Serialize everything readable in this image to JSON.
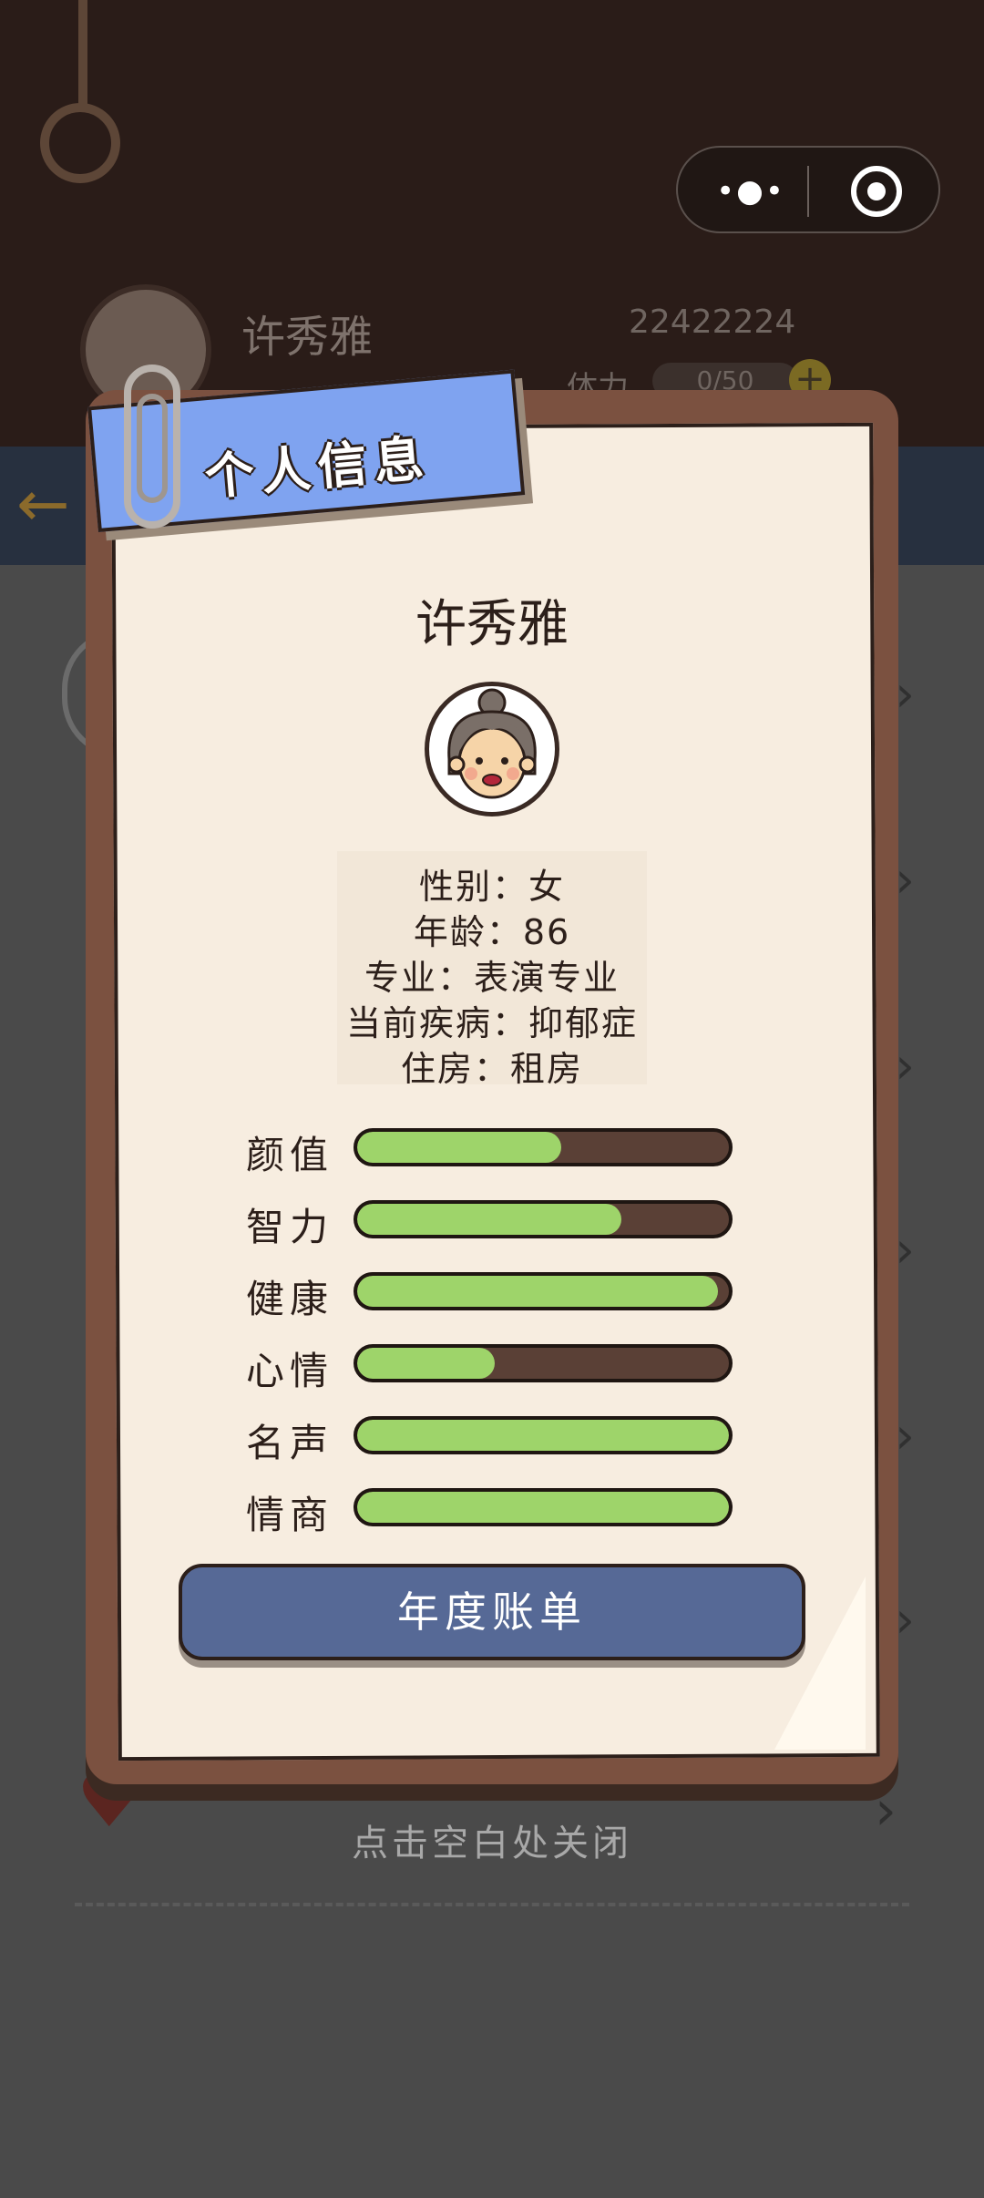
{
  "background": {
    "player_name": "许秀雅",
    "money": "22422224",
    "stamina_label": "体力",
    "stamina_value": "0/50",
    "capsule_menu_icon": "more-dots-icon",
    "capsule_close_icon": "target-close-icon"
  },
  "modal": {
    "banner_title": "个人信息",
    "name": "许秀雅",
    "info": {
      "gender": "性别：女",
      "age": "年龄：86",
      "major": "专业：表演专业",
      "disease": "当前疾病：抑郁症",
      "housing": "住房：租房"
    },
    "stats": [
      {
        "label": "颜值",
        "level": 0.55
      },
      {
        "label": "智力",
        "level": 0.71
      },
      {
        "label": "健康",
        "level": 0.97
      },
      {
        "label": "心情",
        "level": 0.37
      },
      {
        "label": "名声",
        "level": 1.0
      },
      {
        "label": "情商",
        "level": 1.0
      }
    ],
    "annual_button": "年度账单",
    "colors": {
      "bar_fill": "#9ed46a",
      "bar_track": "#5a4036",
      "button": "#566996",
      "banner": "#7fa3f0"
    }
  },
  "close_hint": "点击空白处关闭"
}
